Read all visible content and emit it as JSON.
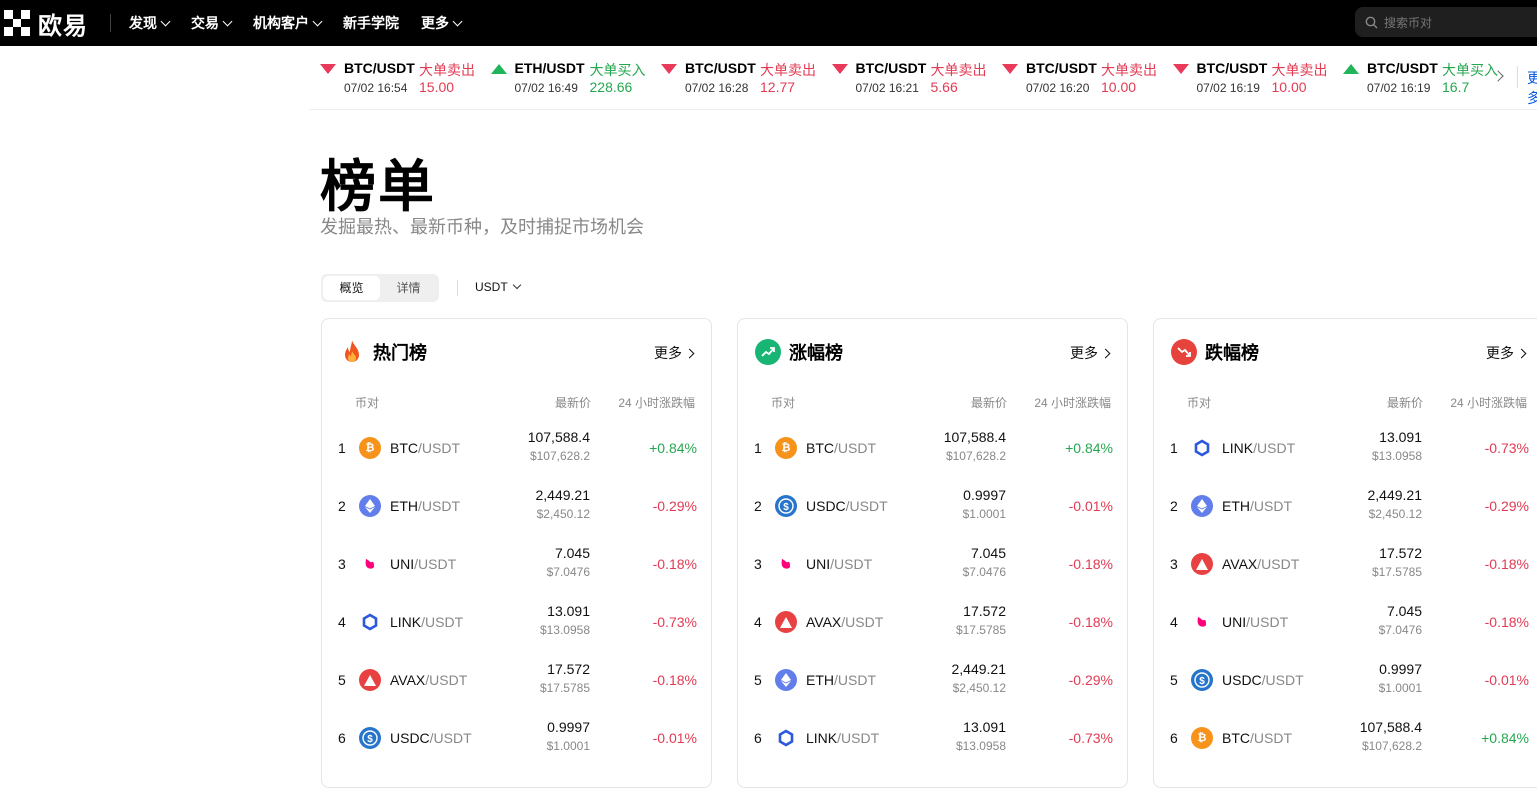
{
  "header": {
    "logo_text": "欧易",
    "nav": [
      {
        "label": "发现",
        "has_caret": true
      },
      {
        "label": "交易",
        "has_caret": true
      },
      {
        "label": "机构客户",
        "has_caret": true
      },
      {
        "label": "新手学院",
        "has_caret": false
      },
      {
        "label": "更多",
        "has_caret": true
      }
    ],
    "search_placeholder": "搜索币对"
  },
  "ticker": {
    "items": [
      {
        "pair": "BTC/USDT",
        "type": "大单卖出",
        "time": "07/02 16:54",
        "amount": "15.00",
        "dir": "down"
      },
      {
        "pair": "ETH/USDT",
        "type": "大单买入",
        "time": "07/02 16:49",
        "amount": "228.66",
        "dir": "up"
      },
      {
        "pair": "BTC/USDT",
        "type": "大单卖出",
        "time": "07/02 16:28",
        "amount": "12.77",
        "dir": "down"
      },
      {
        "pair": "BTC/USDT",
        "type": "大单卖出",
        "time": "07/02 16:21",
        "amount": "5.66",
        "dir": "down"
      },
      {
        "pair": "BTC/USDT",
        "type": "大单卖出",
        "time": "07/02 16:20",
        "amount": "10.00",
        "dir": "down"
      },
      {
        "pair": "BTC/USDT",
        "type": "大单卖出",
        "time": "07/02 16:19",
        "amount": "10.00",
        "dir": "down"
      },
      {
        "pair": "BTC/USDT",
        "type": "大单买入",
        "time": "07/02 16:19",
        "amount": "16.7",
        "dir": "up"
      }
    ],
    "more": "更多"
  },
  "page": {
    "title": "榜单",
    "subtitle": "发掘最热、最新币种，及时捕捉市场机会",
    "tabs": [
      "概览",
      "详情"
    ],
    "quote_currency": "USDT"
  },
  "columns": {
    "pair": "币对",
    "price": "最新价",
    "change": "24 小时涨跌幅"
  },
  "colors": {
    "red": "#e23b54",
    "green": "#25a750"
  },
  "cards": [
    {
      "title": "热门榜",
      "icon": "fire-icon",
      "more": "更多",
      "rows": [
        {
          "rank": "1",
          "coin": "BTC",
          "quote": "/USDT",
          "price": "107,588.4",
          "usd": "$107,628.2",
          "change": "+0.84%"
        },
        {
          "rank": "2",
          "coin": "ETH",
          "quote": "/USDT",
          "price": "2,449.21",
          "usd": "$2,450.12",
          "change": "-0.29%"
        },
        {
          "rank": "3",
          "coin": "UNI",
          "quote": "/USDT",
          "price": "7.045",
          "usd": "$7.0476",
          "change": "-0.18%"
        },
        {
          "rank": "4",
          "coin": "LINK",
          "quote": "/USDT",
          "price": "13.091",
          "usd": "$13.0958",
          "change": "-0.73%"
        },
        {
          "rank": "5",
          "coin": "AVAX",
          "quote": "/USDT",
          "price": "17.572",
          "usd": "$17.5785",
          "change": "-0.18%"
        },
        {
          "rank": "6",
          "coin": "USDC",
          "quote": "/USDT",
          "price": "0.9997",
          "usd": "$1.0001",
          "change": "-0.01%"
        }
      ]
    },
    {
      "title": "涨幅榜",
      "icon": "trend-up-icon",
      "more": "更多",
      "rows": [
        {
          "rank": "1",
          "coin": "BTC",
          "quote": "/USDT",
          "price": "107,588.4",
          "usd": "$107,628.2",
          "change": "+0.84%"
        },
        {
          "rank": "2",
          "coin": "USDC",
          "quote": "/USDT",
          "price": "0.9997",
          "usd": "$1.0001",
          "change": "-0.01%"
        },
        {
          "rank": "3",
          "coin": "UNI",
          "quote": "/USDT",
          "price": "7.045",
          "usd": "$7.0476",
          "change": "-0.18%"
        },
        {
          "rank": "4",
          "coin": "AVAX",
          "quote": "/USDT",
          "price": "17.572",
          "usd": "$17.5785",
          "change": "-0.18%"
        },
        {
          "rank": "5",
          "coin": "ETH",
          "quote": "/USDT",
          "price": "2,449.21",
          "usd": "$2,450.12",
          "change": "-0.29%"
        },
        {
          "rank": "6",
          "coin": "LINK",
          "quote": "/USDT",
          "price": "13.091",
          "usd": "$13.0958",
          "change": "-0.73%"
        }
      ]
    },
    {
      "title": "跌幅榜",
      "icon": "trend-down-icon",
      "more": "更多",
      "rows": [
        {
          "rank": "1",
          "coin": "LINK",
          "quote": "/USDT",
          "price": "13.091",
          "usd": "$13.0958",
          "change": "-0.73%"
        },
        {
          "rank": "2",
          "coin": "ETH",
          "quote": "/USDT",
          "price": "2,449.21",
          "usd": "$2,450.12",
          "change": "-0.29%"
        },
        {
          "rank": "3",
          "coin": "AVAX",
          "quote": "/USDT",
          "price": "17.572",
          "usd": "$17.5785",
          "change": "-0.18%"
        },
        {
          "rank": "4",
          "coin": "UNI",
          "quote": "/USDT",
          "price": "7.045",
          "usd": "$7.0476",
          "change": "-0.18%"
        },
        {
          "rank": "5",
          "coin": "USDC",
          "quote": "/USDT",
          "price": "0.9997",
          "usd": "$1.0001",
          "change": "-0.01%"
        },
        {
          "rank": "6",
          "coin": "BTC",
          "quote": "/USDT",
          "price": "107,588.4",
          "usd": "$107,628.2",
          "change": "+0.84%"
        }
      ]
    }
  ]
}
